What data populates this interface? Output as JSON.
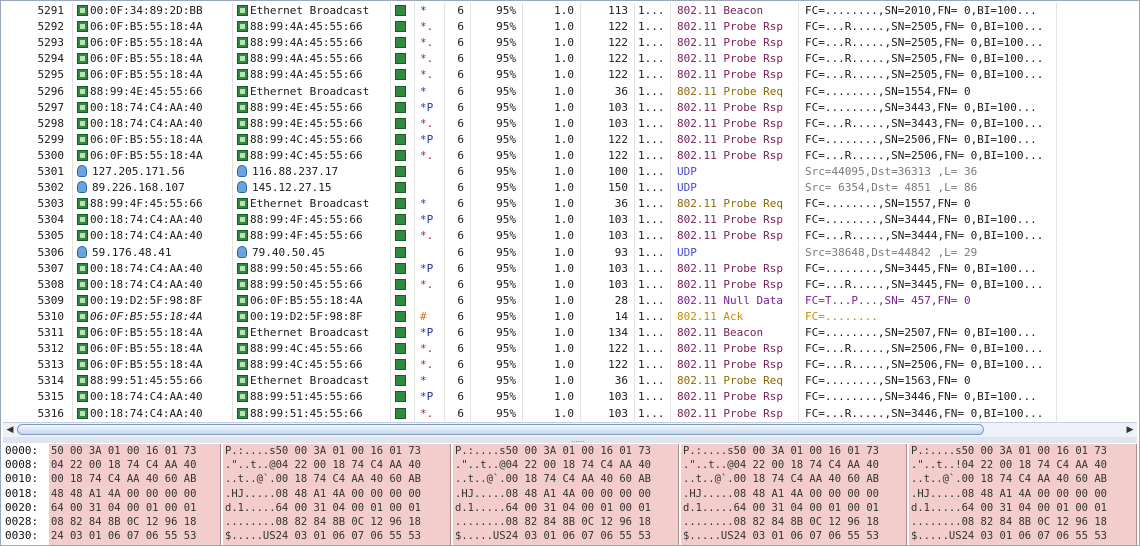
{
  "packets": [
    {
      "no": "5291",
      "src": "00:0F:34:89:2D:BB",
      "dst": "Ethernet Broadcast",
      "flags": "*",
      "ch": "6",
      "signal": "95%",
      "rate": "1.0",
      "size": "113",
      "dots": "1...",
      "protocol": "802.11 Beacon",
      "summary": "FC=........,SN=2010,FN= 0,BI=100..."
    },
    {
      "no": "5292",
      "src": "06:0F:B5:55:18:4A",
      "dst": "88:99:4A:45:55:66",
      "flags": "*.",
      "ch": "6",
      "signal": "95%",
      "rate": "1.0",
      "size": "122",
      "dots": "1...",
      "protocol": "802.11 Probe Rsp",
      "summary": "FC=...R.....,SN=2505,FN= 0,BI=100..."
    },
    {
      "no": "5293",
      "src": "06:0F:B5:55:18:4A",
      "dst": "88:99:4A:45:55:66",
      "flags": "*.",
      "ch": "6",
      "signal": "95%",
      "rate": "1.0",
      "size": "122",
      "dots": "1...",
      "protocol": "802.11 Probe Rsp",
      "summary": "FC=...R.....,SN=2505,FN= 0,BI=100..."
    },
    {
      "no": "5294",
      "src": "06:0F:B5:55:18:4A",
      "dst": "88:99:4A:45:55:66",
      "flags": "*.",
      "ch": "6",
      "signal": "95%",
      "rate": "1.0",
      "size": "122",
      "dots": "1...",
      "protocol": "802.11 Probe Rsp",
      "summary": "FC=...R.....,SN=2505,FN= 0,BI=100..."
    },
    {
      "no": "5295",
      "src": "06:0F:B5:55:18:4A",
      "dst": "88:99:4A:45:55:66",
      "flags": "*.",
      "ch": "6",
      "signal": "95%",
      "rate": "1.0",
      "size": "122",
      "dots": "1...",
      "protocol": "802.11 Probe Rsp",
      "summary": "FC=...R.....,SN=2505,FN= 0,BI=100..."
    },
    {
      "no": "5296",
      "src": "88:99:4E:45:55:66",
      "dst": "Ethernet Broadcast",
      "flags": "*",
      "ch": "6",
      "signal": "95%",
      "rate": "1.0",
      "size": "36",
      "dots": "1...",
      "protocol": "802.11 Probe Req",
      "summary": "FC=........,SN=1554,FN= 0"
    },
    {
      "no": "5297",
      "src": "00:18:74:C4:AA:40",
      "dst": "88:99:4E:45:55:66",
      "flags": "*P",
      "ch": "6",
      "signal": "95%",
      "rate": "1.0",
      "size": "103",
      "dots": "1...",
      "protocol": "802.11 Probe Rsp",
      "summary": "FC=........,SN=3443,FN= 0,BI=100..."
    },
    {
      "no": "5298",
      "src": "00:18:74:C4:AA:40",
      "dst": "88:99:4E:45:55:66",
      "flags": "*.",
      "ch": "6",
      "signal": "95%",
      "rate": "1.0",
      "size": "103",
      "dots": "1...",
      "protocol": "802.11 Probe Rsp",
      "summary": "FC=...R.....,SN=3443,FN= 0,BI=100..."
    },
    {
      "no": "5299",
      "src": "06:0F:B5:55:18:4A",
      "dst": "88:99:4C:45:55:66",
      "flags": "*P",
      "ch": "6",
      "signal": "95%",
      "rate": "1.0",
      "size": "122",
      "dots": "1...",
      "protocol": "802.11 Probe Rsp",
      "summary": "FC=........,SN=2506,FN= 0,BI=100..."
    },
    {
      "no": "5300",
      "src": "06:0F:B5:55:18:4A",
      "dst": "88:99:4C:45:55:66",
      "flags": "*.",
      "ch": "6",
      "signal": "95%",
      "rate": "1.0",
      "size": "122",
      "dots": "1...",
      "protocol": "802.11 Probe Rsp",
      "summary": "FC=...R.....,SN=2506,FN= 0,BI=100..."
    },
    {
      "no": "5301",
      "src": "127.205.171.56",
      "dst": "116.88.237.17",
      "flags": "",
      "ch": "6",
      "signal": "95%",
      "rate": "1.0",
      "size": "100",
      "dots": "1...",
      "protocol": "UDP",
      "summary": "Src=44095,Dst=36313 ,L=    36"
    },
    {
      "no": "5302",
      "src": "89.226.168.107",
      "dst": "145.12.27.15",
      "flags": "",
      "ch": "6",
      "signal": "95%",
      "rate": "1.0",
      "size": "150",
      "dots": "1...",
      "protocol": "UDP",
      "summary": "Src= 6354,Dst= 4851 ,L=    86"
    },
    {
      "no": "5303",
      "src": "88:99:4F:45:55:66",
      "dst": "Ethernet Broadcast",
      "flags": "*",
      "ch": "6",
      "signal": "95%",
      "rate": "1.0",
      "size": "36",
      "dots": "1...",
      "protocol": "802.11 Probe Req",
      "summary": "FC=........,SN=1557,FN= 0"
    },
    {
      "no": "5304",
      "src": "00:18:74:C4:AA:40",
      "dst": "88:99:4F:45:55:66",
      "flags": "*P",
      "ch": "6",
      "signal": "95%",
      "rate": "1.0",
      "size": "103",
      "dots": "1...",
      "protocol": "802.11 Probe Rsp",
      "summary": "FC=........,SN=3444,FN= 0,BI=100..."
    },
    {
      "no": "5305",
      "src": "00:18:74:C4:AA:40",
      "dst": "88:99:4F:45:55:66",
      "flags": "*.",
      "ch": "6",
      "signal": "95%",
      "rate": "1.0",
      "size": "103",
      "dots": "1...",
      "protocol": "802.11 Probe Rsp",
      "summary": "FC=...R.....,SN=3444,FN= 0,BI=100..."
    },
    {
      "no": "5306",
      "src": "59.176.48.41",
      "dst": "79.40.50.45",
      "flags": "",
      "ch": "6",
      "signal": "95%",
      "rate": "1.0",
      "size": "93",
      "dots": "1...",
      "protocol": "UDP",
      "summary": "Src=38648,Dst=44842 ,L=    29"
    },
    {
      "no": "5307",
      "src": "00:18:74:C4:AA:40",
      "dst": "88:99:50:45:55:66",
      "flags": "*P",
      "ch": "6",
      "signal": "95%",
      "rate": "1.0",
      "size": "103",
      "dots": "1...",
      "protocol": "802.11 Probe Rsp",
      "summary": "FC=........,SN=3445,FN= 0,BI=100..."
    },
    {
      "no": "5308",
      "src": "00:18:74:C4:AA:40",
      "dst": "88:99:50:45:55:66",
      "flags": "*.",
      "ch": "6",
      "signal": "95%",
      "rate": "1.0",
      "size": "103",
      "dots": "1...",
      "protocol": "802.11 Probe Rsp",
      "summary": "FC=...R.....,SN=3445,FN= 0,BI=100..."
    },
    {
      "no": "5309",
      "src": "00:19:D2:5F:98:8F",
      "dst": "06:0F:B5:55:18:4A",
      "flags": "",
      "ch": "6",
      "signal": "95%",
      "rate": "1.0",
      "size": "28",
      "dots": "1...",
      "protocol": "802.11 Null Data",
      "summary": "FC=T...P...,SN= 457,FN= 0"
    },
    {
      "no": "5310",
      "src": "06:0F:B5:55:18:4A",
      "dst": "00:19:D2:5F:98:8F",
      "flags": "#",
      "ch": "6",
      "signal": "95%",
      "rate": "1.0",
      "size": "14",
      "dots": "1...",
      "protocol": "802.11 Ack",
      "summary": "FC=........"
    },
    {
      "no": "5311",
      "src": "06:0F:B5:55:18:4A",
      "dst": "Ethernet Broadcast",
      "flags": "*P",
      "ch": "6",
      "signal": "95%",
      "rate": "1.0",
      "size": "134",
      "dots": "1...",
      "protocol": "802.11 Beacon",
      "summary": "FC=........,SN=2507,FN= 0,BI=100..."
    },
    {
      "no": "5312",
      "src": "06:0F:B5:55:18:4A",
      "dst": "88:99:4C:45:55:66",
      "flags": "*.",
      "ch": "6",
      "signal": "95%",
      "rate": "1.0",
      "size": "122",
      "dots": "1...",
      "protocol": "802.11 Probe Rsp",
      "summary": "FC=...R.....,SN=2506,FN= 0,BI=100..."
    },
    {
      "no": "5313",
      "src": "06:0F:B5:55:18:4A",
      "dst": "88:99:4C:45:55:66",
      "flags": "*.",
      "ch": "6",
      "signal": "95%",
      "rate": "1.0",
      "size": "122",
      "dots": "1...",
      "protocol": "802.11 Probe Rsp",
      "summary": "FC=...R.....,SN=2506,FN= 0,BI=100..."
    },
    {
      "no": "5314",
      "src": "88:99:51:45:55:66",
      "dst": "Ethernet Broadcast",
      "flags": "*",
      "ch": "6",
      "signal": "95%",
      "rate": "1.0",
      "size": "36",
      "dots": "1...",
      "protocol": "802.11 Probe Req",
      "summary": "FC=........,SN=1563,FN= 0"
    },
    {
      "no": "5315",
      "src": "00:18:74:C4:AA:40",
      "dst": "88:99:51:45:55:66",
      "flags": "*P",
      "ch": "6",
      "signal": "95%",
      "rate": "1.0",
      "size": "103",
      "dots": "1...",
      "protocol": "802.11 Probe Rsp",
      "summary": "FC=........,SN=3446,FN= 0,BI=100..."
    },
    {
      "no": "5316",
      "src": "00:18:74:C4:AA:40",
      "dst": "88:99:51:45:55:66",
      "flags": "*.",
      "ch": "6",
      "signal": "95%",
      "rate": "1.0",
      "size": "103",
      "dots": "1...",
      "protocol": "802.11 Probe Rsp",
      "summary": "FC=...R.....,SN=3446,FN= 0,BI=100..."
    }
  ],
  "scrollbar": {
    "left_arrow": "◀",
    "right_arrow": "▶"
  },
  "splitter": {
    "grip": "......"
  },
  "hex": {
    "offsets": [
      "0000:",
      "0008:",
      "0010:",
      "0018:",
      "0020:",
      "0028:",
      "0030:"
    ],
    "columns": [
      [
        "50 00 3A 01 00 16 01 73",
        "04 22 00 18 74 C4 AA 40",
        "00 18 74 C4 AA 40 60 AB",
        "48 48 A1 4A 00 00 00 00",
        "64 00 31 04 00 01 00 01",
        "08 82 84 8B 0C 12 96 18",
        "24 03 01 06 07 06 55 53"
      ],
      [
        "P.:....s50 00 3A 01 00 16 01 73",
        ".\"..t..@04 22 00 18 74 C4 AA 40",
        "..t..@`.00 18 74 C4 AA 40 60 AB",
        ".HJ.....08 48 A1 4A 00 00 00 00",
        "d.1.....64 00 31 04 00 01 00 01",
        "........08 82 84 8B 0C 12 96 18",
        "$.....US24 03 01 06 07 06 55 53"
      ],
      [
        "P.:....s50 00 3A 01 00 16 01 73",
        ".\"..t..@04 22 00 18 74 C4 AA 40",
        "..t..@`.00 18 74 C4 AA 40 60 AB",
        ".HJ.....08 48 A1 4A 00 00 00 00",
        "d.1.....64 00 31 04 00 01 00 01",
        "........08 82 84 8B 0C 12 96 18",
        "$.....US24 03 01 06 07 06 55 53"
      ],
      [
        "P.:....s50 00 3A 01 00 16 01 73",
        ".\"..t..@04 22 00 18 74 C4 AA 40",
        "..t..@`.00 18 74 C4 AA 40 60 AB",
        ".HJ.....08 48 A1 4A 00 00 00 00",
        "d.1.....64 00 31 04 00 01 00 01",
        "........08 82 84 8B 0C 12 96 18",
        "$.....US24 03 01 06 07 06 55 53"
      ],
      [
        "P.:....s50 00 3A 01 00 16 01 73",
        ".\"..t..!04 22 00 18 74 C4 AA 40",
        "..t..@`.00 18 74 C4 AA 40 60 AB",
        ".HJ.....08 48 A1 4A 00 00 00 00",
        "d.1.....64 00 31 04 00 01 00 01",
        "........08 82 84 8B 0C 12 96 18",
        "$.....US24 03 01 06 07 06 55 53"
      ]
    ]
  },
  "colors": {
    "hex_bg": "#f3cccc",
    "selection": "#ffffff",
    "flag_star": "#1c35b0",
    "flag_dot": "#b01c1c"
  }
}
